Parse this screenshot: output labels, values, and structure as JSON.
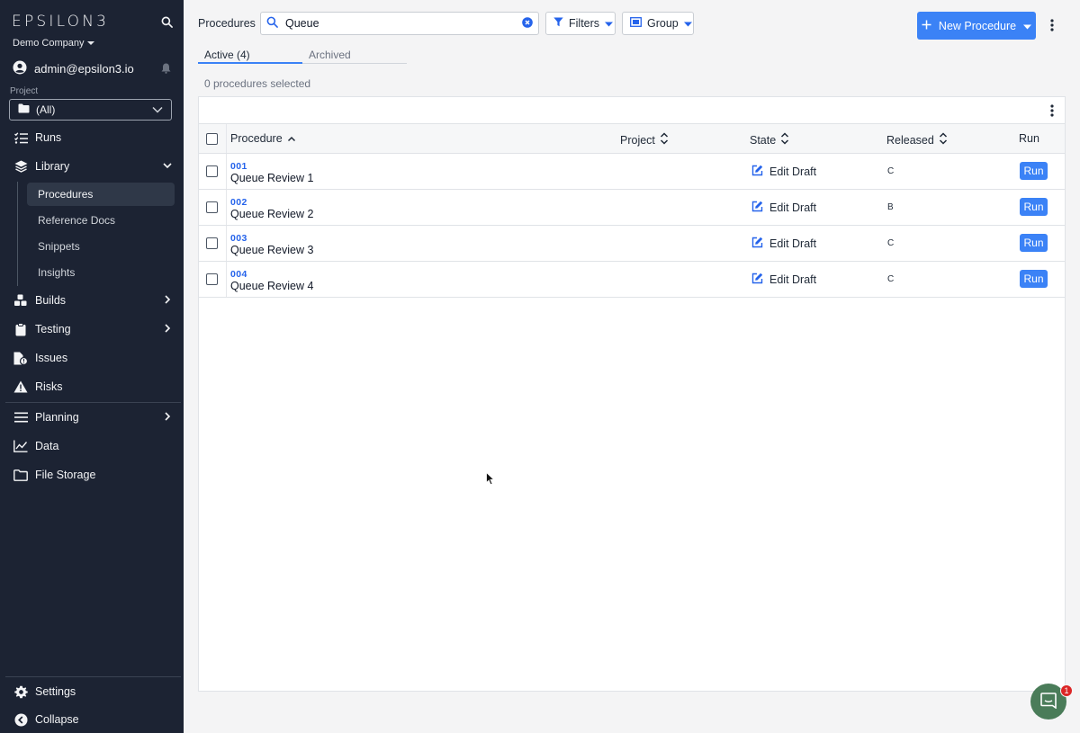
{
  "sidebar": {
    "logo": "EPSILON3",
    "company": "Demo Company",
    "user": "admin@epsilon3.io",
    "project_label": "Project",
    "project_value": "(All)",
    "nav": {
      "runs": "Runs",
      "library": "Library",
      "builds": "Builds",
      "testing": "Testing",
      "issues": "Issues",
      "risks": "Risks",
      "planning": "Planning",
      "data": "Data",
      "file_storage": "File Storage",
      "settings": "Settings",
      "collapse": "Collapse"
    },
    "library_items": [
      "Procedures",
      "Reference Docs",
      "Snippets",
      "Insights"
    ]
  },
  "header": {
    "breadcrumb": "Procedures",
    "search_value": "Queue",
    "filters_label": "Filters",
    "group_label": "Group",
    "new_procedure_label": "New Procedure"
  },
  "tabs": {
    "active": "Active (4)",
    "archived": "Archived"
  },
  "selected_count": "0 procedures selected",
  "table": {
    "columns": {
      "procedure": "Procedure",
      "project": "Project",
      "state": "State",
      "released": "Released",
      "run": "Run"
    },
    "rows": [
      {
        "id": "001",
        "name": "Queue Review 1",
        "state": "Edit Draft",
        "released": "C",
        "run": "Run"
      },
      {
        "id": "002",
        "name": "Queue Review 2",
        "state": "Edit Draft",
        "released": "B",
        "run": "Run"
      },
      {
        "id": "003",
        "name": "Queue Review 3",
        "state": "Edit Draft",
        "released": "C",
        "run": "Run"
      },
      {
        "id": "004",
        "name": "Queue Review 4",
        "state": "Edit Draft",
        "released": "C",
        "run": "Run"
      }
    ]
  },
  "chat_badge": "1",
  "colors": {
    "sidebar_bg": "#1c2333",
    "accent": "#3b82f6",
    "link": "#2563eb",
    "chat_bg": "#4a7c59",
    "badge": "#dc2626"
  }
}
